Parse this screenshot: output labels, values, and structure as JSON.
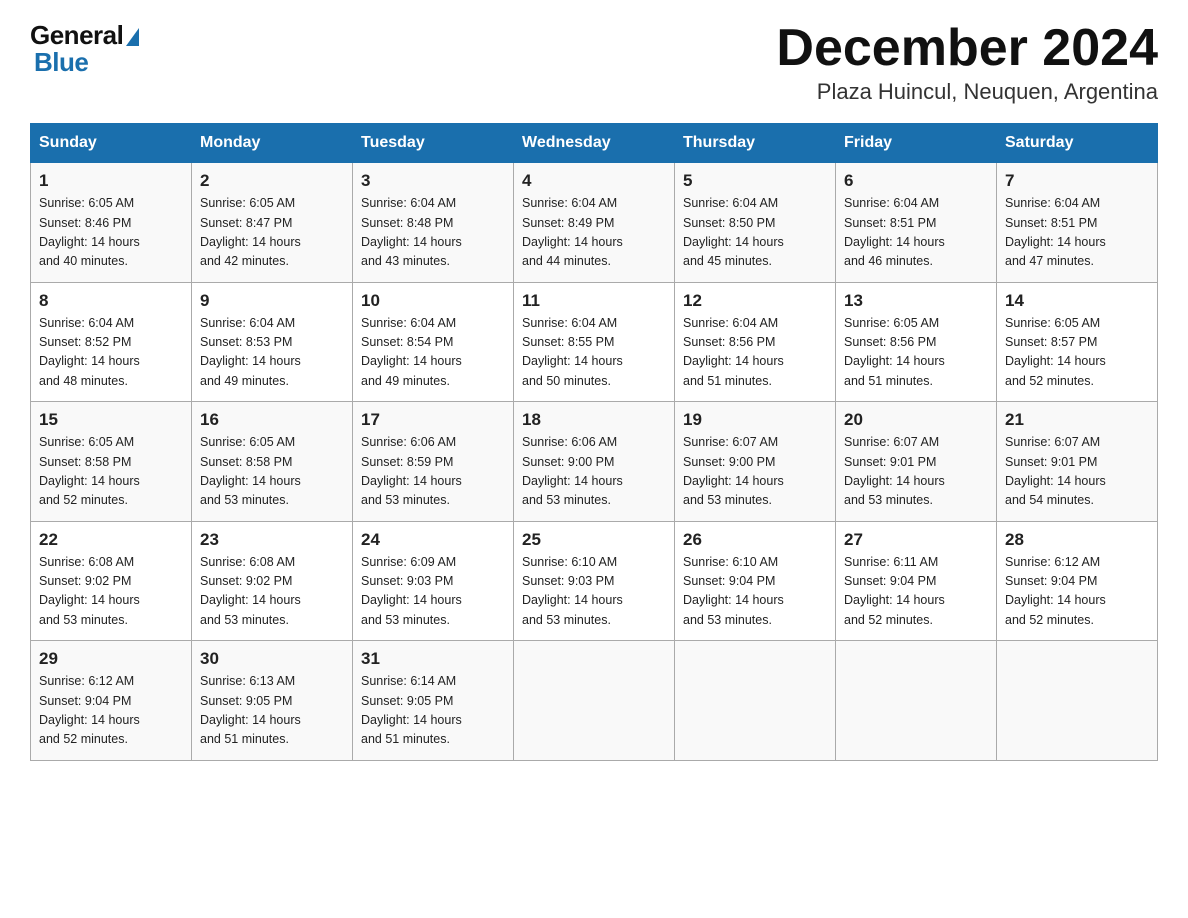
{
  "header": {
    "logo_general": "General",
    "logo_blue": "Blue",
    "title": "December 2024",
    "subtitle": "Plaza Huincul, Neuquen, Argentina"
  },
  "days_of_week": [
    "Sunday",
    "Monday",
    "Tuesday",
    "Wednesday",
    "Thursday",
    "Friday",
    "Saturday"
  ],
  "weeks": [
    [
      {
        "day": "1",
        "info": "Sunrise: 6:05 AM\nSunset: 8:46 PM\nDaylight: 14 hours\nand 40 minutes."
      },
      {
        "day": "2",
        "info": "Sunrise: 6:05 AM\nSunset: 8:47 PM\nDaylight: 14 hours\nand 42 minutes."
      },
      {
        "day": "3",
        "info": "Sunrise: 6:04 AM\nSunset: 8:48 PM\nDaylight: 14 hours\nand 43 minutes."
      },
      {
        "day": "4",
        "info": "Sunrise: 6:04 AM\nSunset: 8:49 PM\nDaylight: 14 hours\nand 44 minutes."
      },
      {
        "day": "5",
        "info": "Sunrise: 6:04 AM\nSunset: 8:50 PM\nDaylight: 14 hours\nand 45 minutes."
      },
      {
        "day": "6",
        "info": "Sunrise: 6:04 AM\nSunset: 8:51 PM\nDaylight: 14 hours\nand 46 minutes."
      },
      {
        "day": "7",
        "info": "Sunrise: 6:04 AM\nSunset: 8:51 PM\nDaylight: 14 hours\nand 47 minutes."
      }
    ],
    [
      {
        "day": "8",
        "info": "Sunrise: 6:04 AM\nSunset: 8:52 PM\nDaylight: 14 hours\nand 48 minutes."
      },
      {
        "day": "9",
        "info": "Sunrise: 6:04 AM\nSunset: 8:53 PM\nDaylight: 14 hours\nand 49 minutes."
      },
      {
        "day": "10",
        "info": "Sunrise: 6:04 AM\nSunset: 8:54 PM\nDaylight: 14 hours\nand 49 minutes."
      },
      {
        "day": "11",
        "info": "Sunrise: 6:04 AM\nSunset: 8:55 PM\nDaylight: 14 hours\nand 50 minutes."
      },
      {
        "day": "12",
        "info": "Sunrise: 6:04 AM\nSunset: 8:56 PM\nDaylight: 14 hours\nand 51 minutes."
      },
      {
        "day": "13",
        "info": "Sunrise: 6:05 AM\nSunset: 8:56 PM\nDaylight: 14 hours\nand 51 minutes."
      },
      {
        "day": "14",
        "info": "Sunrise: 6:05 AM\nSunset: 8:57 PM\nDaylight: 14 hours\nand 52 minutes."
      }
    ],
    [
      {
        "day": "15",
        "info": "Sunrise: 6:05 AM\nSunset: 8:58 PM\nDaylight: 14 hours\nand 52 minutes."
      },
      {
        "day": "16",
        "info": "Sunrise: 6:05 AM\nSunset: 8:58 PM\nDaylight: 14 hours\nand 53 minutes."
      },
      {
        "day": "17",
        "info": "Sunrise: 6:06 AM\nSunset: 8:59 PM\nDaylight: 14 hours\nand 53 minutes."
      },
      {
        "day": "18",
        "info": "Sunrise: 6:06 AM\nSunset: 9:00 PM\nDaylight: 14 hours\nand 53 minutes."
      },
      {
        "day": "19",
        "info": "Sunrise: 6:07 AM\nSunset: 9:00 PM\nDaylight: 14 hours\nand 53 minutes."
      },
      {
        "day": "20",
        "info": "Sunrise: 6:07 AM\nSunset: 9:01 PM\nDaylight: 14 hours\nand 53 minutes."
      },
      {
        "day": "21",
        "info": "Sunrise: 6:07 AM\nSunset: 9:01 PM\nDaylight: 14 hours\nand 54 minutes."
      }
    ],
    [
      {
        "day": "22",
        "info": "Sunrise: 6:08 AM\nSunset: 9:02 PM\nDaylight: 14 hours\nand 53 minutes."
      },
      {
        "day": "23",
        "info": "Sunrise: 6:08 AM\nSunset: 9:02 PM\nDaylight: 14 hours\nand 53 minutes."
      },
      {
        "day": "24",
        "info": "Sunrise: 6:09 AM\nSunset: 9:03 PM\nDaylight: 14 hours\nand 53 minutes."
      },
      {
        "day": "25",
        "info": "Sunrise: 6:10 AM\nSunset: 9:03 PM\nDaylight: 14 hours\nand 53 minutes."
      },
      {
        "day": "26",
        "info": "Sunrise: 6:10 AM\nSunset: 9:04 PM\nDaylight: 14 hours\nand 53 minutes."
      },
      {
        "day": "27",
        "info": "Sunrise: 6:11 AM\nSunset: 9:04 PM\nDaylight: 14 hours\nand 52 minutes."
      },
      {
        "day": "28",
        "info": "Sunrise: 6:12 AM\nSunset: 9:04 PM\nDaylight: 14 hours\nand 52 minutes."
      }
    ],
    [
      {
        "day": "29",
        "info": "Sunrise: 6:12 AM\nSunset: 9:04 PM\nDaylight: 14 hours\nand 52 minutes."
      },
      {
        "day": "30",
        "info": "Sunrise: 6:13 AM\nSunset: 9:05 PM\nDaylight: 14 hours\nand 51 minutes."
      },
      {
        "day": "31",
        "info": "Sunrise: 6:14 AM\nSunset: 9:05 PM\nDaylight: 14 hours\nand 51 minutes."
      },
      {
        "day": "",
        "info": ""
      },
      {
        "day": "",
        "info": ""
      },
      {
        "day": "",
        "info": ""
      },
      {
        "day": "",
        "info": ""
      }
    ]
  ]
}
